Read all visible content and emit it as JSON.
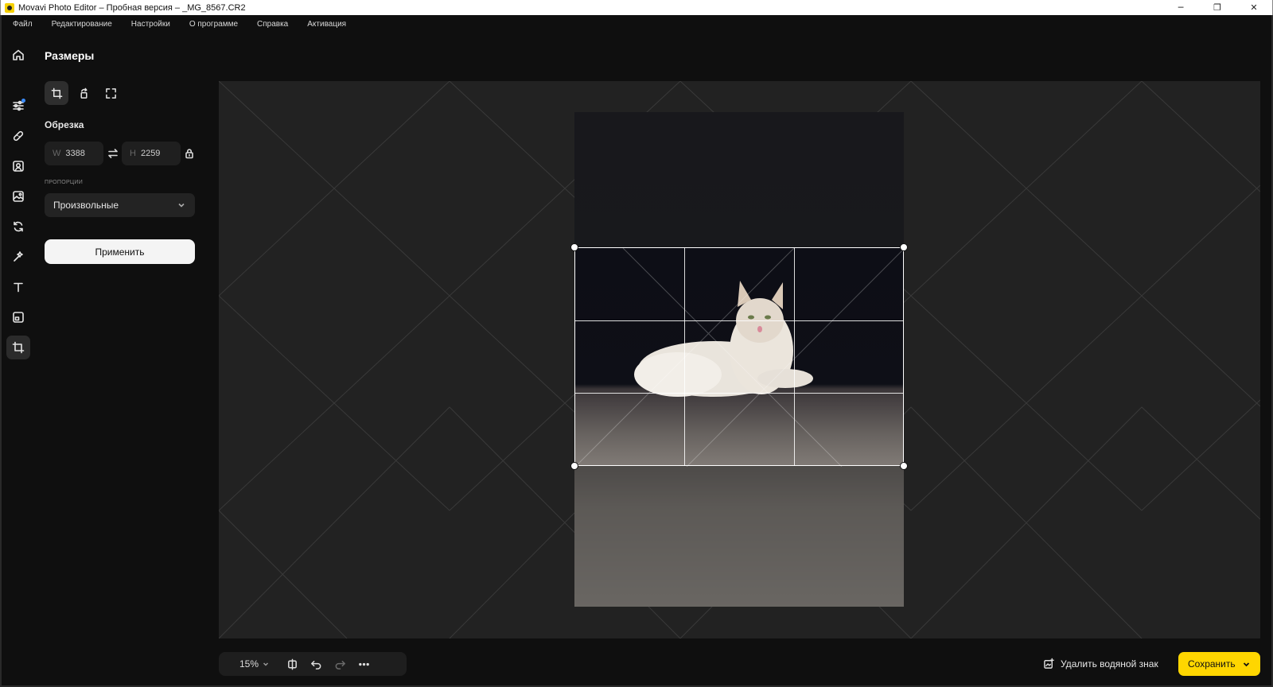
{
  "window": {
    "title": "Movavi Photo Editor – Пробная версия – _MG_8567.CR2",
    "minimize": "─",
    "restore": "❐",
    "close": "✕"
  },
  "menu": [
    "Файл",
    "Редактирование",
    "Настройки",
    "О программе",
    "Справка",
    "Активация"
  ],
  "sidebar_tools": [
    "home-icon",
    "adjust-sliders-icon",
    "retouch-bandage-icon",
    "portrait-icon",
    "image-replace-icon",
    "rotate-icon",
    "magic-wand-icon",
    "text-icon",
    "frame-icon",
    "crop-icon"
  ],
  "panel": {
    "title": "Размеры",
    "section": "Обрезка",
    "width_prefix": "W",
    "width_value": "3388",
    "height_prefix": "H",
    "height_value": "2259",
    "proportions_label": "ПРОПОРЦИИ",
    "proportions_value": "Произвольные",
    "apply": "Применить"
  },
  "bottom": {
    "zoom": "15%",
    "remove_watermark": "Удалить водяной знак",
    "save": "Сохранить"
  },
  "colors": {
    "accent": "#ffd600",
    "active_dot": "#3b8cff",
    "background": "#0f0f0f",
    "canvas": "#222222"
  }
}
